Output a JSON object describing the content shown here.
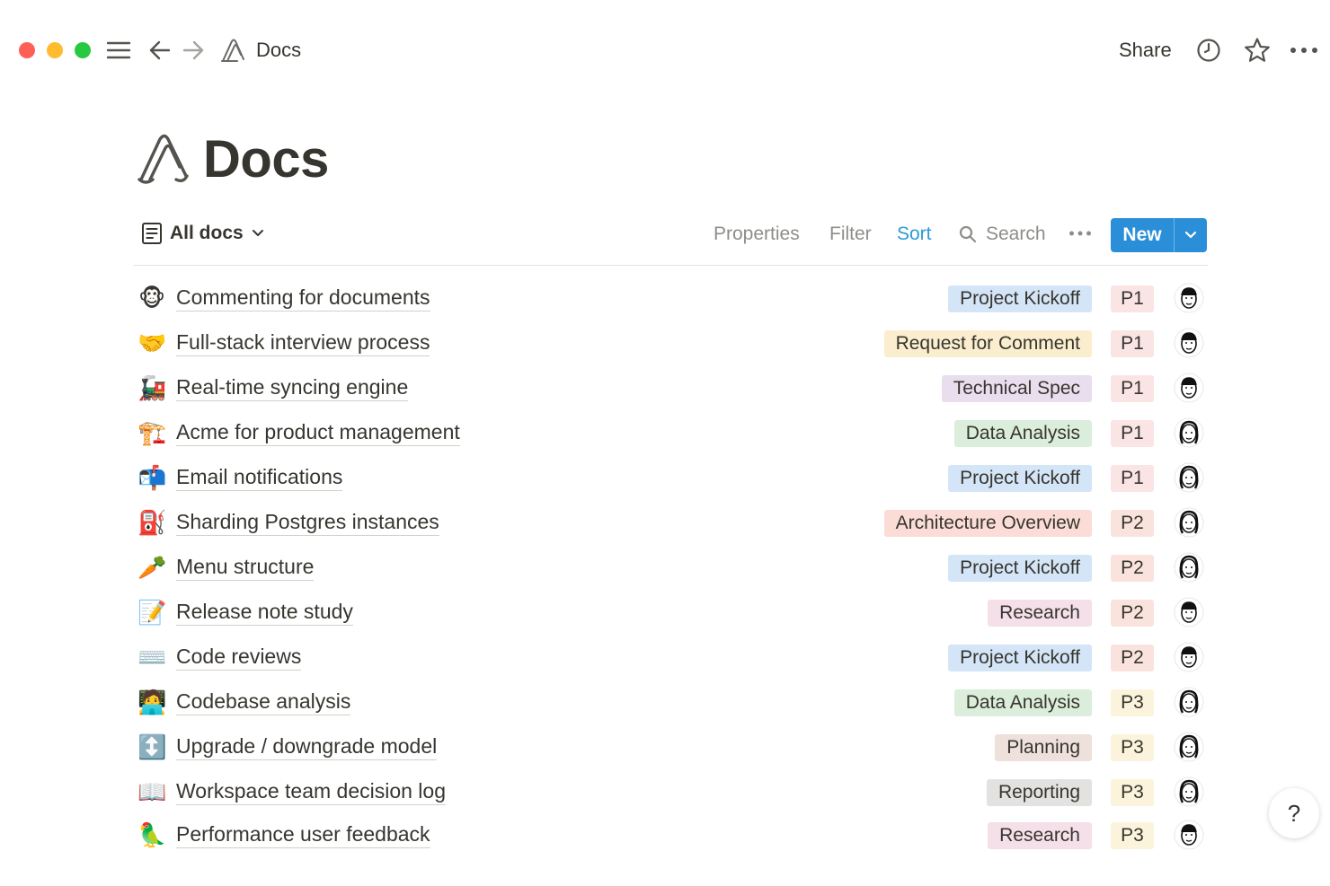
{
  "window": {
    "breadcrumb": "Docs",
    "share_label": "Share",
    "icons": [
      "menu-icon",
      "back-arrow-icon",
      "forward-arrow-icon",
      "paperclip-logo-icon",
      "clock-icon",
      "star-icon",
      "more-icon"
    ]
  },
  "page": {
    "title": "Docs"
  },
  "toolbar": {
    "view_label": "All docs",
    "properties": "Properties",
    "filter": "Filter",
    "sort": "Sort",
    "search": "Search",
    "new_label": "New"
  },
  "colors": {
    "accent": "#2a8ed8",
    "sort_active": "#2b9bd6",
    "tag_project_kickoff": "#d3e5f7",
    "tag_request_for_comment": "#fbeecf",
    "tag_technical_spec": "#e8deee",
    "tag_data_analysis": "#dbeddb",
    "tag_architecture_overview": "#fbdcd6",
    "tag_research": "#f5e0e9",
    "tag_planning": "#eee0da",
    "tag_reporting": "#e3e2e0",
    "p1": "#fbe4e4",
    "p2": "#fae3dd",
    "p3": "#fbf3db"
  },
  "rows": [
    {
      "emoji": "🐵",
      "title": "Commenting for documents",
      "tag": "Project Kickoff",
      "tag_color": "#d3e5f7",
      "priority": "P1",
      "priority_color": "#fbe4e4"
    },
    {
      "emoji": "🤝",
      "title": "Full-stack interview process",
      "tag": "Request for Comment",
      "tag_color": "#fbeecf",
      "priority": "P1",
      "priority_color": "#fbe4e4"
    },
    {
      "emoji": "🚂",
      "title": "Real-time syncing engine",
      "tag": "Technical Spec",
      "tag_color": "#e8deee",
      "priority": "P1",
      "priority_color": "#fbe4e4"
    },
    {
      "emoji": "🏗️",
      "title": "Acme for product management",
      "tag": "Data Analysis",
      "tag_color": "#dbeddb",
      "priority": "P1",
      "priority_color": "#fbe4e4"
    },
    {
      "emoji": "📬",
      "title": "Email notifications",
      "tag": "Project Kickoff",
      "tag_color": "#d3e5f7",
      "priority": "P1",
      "priority_color": "#fbe4e4"
    },
    {
      "emoji": "⛽",
      "title": "Sharding Postgres instances",
      "tag": "Architecture Overview",
      "tag_color": "#fbdcd6",
      "priority": "P2",
      "priority_color": "#fae3dd"
    },
    {
      "emoji": "🥕",
      "title": "Menu structure",
      "tag": "Project Kickoff",
      "tag_color": "#d3e5f7",
      "priority": "P2",
      "priority_color": "#fae3dd"
    },
    {
      "emoji": "📝",
      "title": "Release note study",
      "tag": "Research",
      "tag_color": "#f5e0e9",
      "priority": "P2",
      "priority_color": "#fae3dd"
    },
    {
      "emoji": "⌨️",
      "title": "Code reviews",
      "tag": "Project Kickoff",
      "tag_color": "#d3e5f7",
      "priority": "P2",
      "priority_color": "#fae3dd"
    },
    {
      "emoji": "🧑‍💻",
      "title": "Codebase analysis",
      "tag": "Data Analysis",
      "tag_color": "#dbeddb",
      "priority": "P3",
      "priority_color": "#fbf3db"
    },
    {
      "emoji": "↕️",
      "title": "Upgrade / downgrade model",
      "tag": "Planning",
      "tag_color": "#eee0da",
      "priority": "P3",
      "priority_color": "#fbf3db"
    },
    {
      "emoji": "📖",
      "title": "Workspace team decision log",
      "tag": "Reporting",
      "tag_color": "#e3e2e0",
      "priority": "P3",
      "priority_color": "#fbf3db"
    },
    {
      "emoji": "🦜",
      "title": "Performance user feedback",
      "tag": "Research",
      "tag_color": "#f5e0e9",
      "priority": "P3",
      "priority_color": "#fbf3db"
    }
  ],
  "help": {
    "label": "?"
  }
}
